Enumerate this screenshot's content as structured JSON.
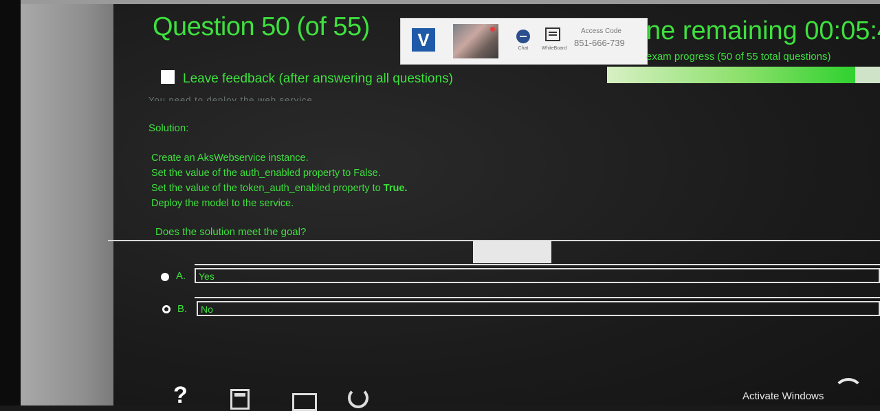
{
  "question": {
    "title": "Question 50 (of 55)"
  },
  "proctor": {
    "logo_letter": "V",
    "chat_label": "Chat",
    "whiteboard_label": "WhiteBoard",
    "access_label": "Access Code",
    "access_code": "851-666-739"
  },
  "timer": {
    "text": "ne remaining 00:05:4",
    "progress_text": "exam progress (50 of 55 total questions)",
    "progress": 0.909
  },
  "feedback": {
    "label": "Leave feedback (after answering all questions)",
    "checked": false
  },
  "cut_text": "You need to deploy the web service.",
  "solution": {
    "label": "Solution:",
    "line1": "Create an AksWebservice instance.",
    "line2": "Set the value of the auth_enabled property to False.",
    "line3_pre": "Set the value of the token_auth_enabled property to ",
    "line3_bold": "True.",
    "line4": "Deploy the model to the service."
  },
  "goal": "Does the solution meet the goal?",
  "answers": [
    {
      "letter": "A.",
      "text": "Yes",
      "selected": true
    },
    {
      "letter": "B.",
      "text": "No",
      "selected": false
    }
  ],
  "toolbar": {
    "help_glyph": "?"
  },
  "windows": {
    "activate": "Activate Windows"
  },
  "colors": {
    "accent": "#3ee03e",
    "progress": "#2fd12f"
  }
}
